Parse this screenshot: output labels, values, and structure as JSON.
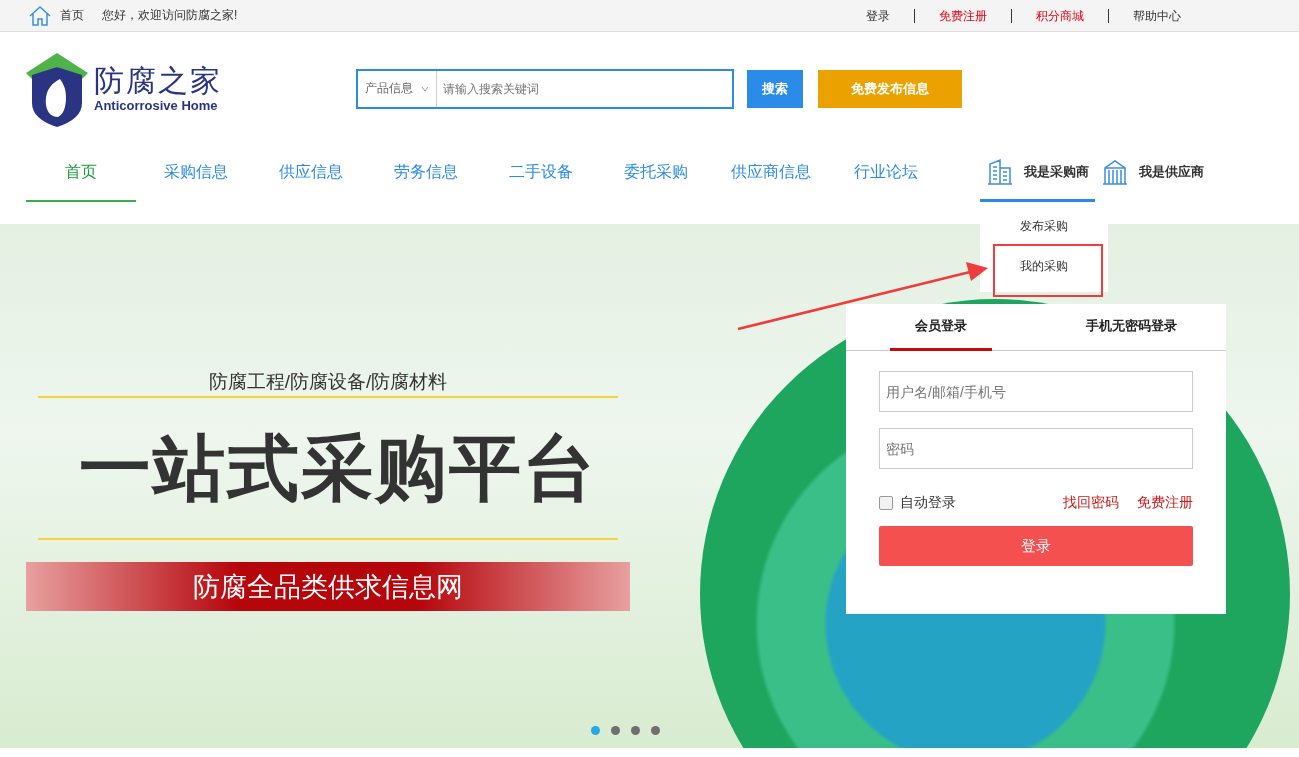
{
  "top_bar": {
    "home_link": "首页",
    "greeting": "您好，欢迎访问防腐之家!",
    "links": [
      {
        "label": "登录",
        "kind": "normal"
      },
      {
        "label": "免费注册",
        "kind": "highlight"
      },
      {
        "label": "积分商城",
        "kind": "highlight"
      },
      {
        "label": "帮助中心",
        "kind": "normal"
      }
    ]
  },
  "header": {
    "logo_name": "防腐之家",
    "logo_subtitle": "Anticorrosive Home",
    "search": {
      "category": "产品信息",
      "placeholder": "请输入搜索关键词",
      "button": "搜索"
    },
    "publish_button": "免费发布信息"
  },
  "nav": {
    "items": [
      {
        "label": "首页",
        "selected": true
      },
      {
        "label": "采购信息",
        "selected": false
      },
      {
        "label": "供应信息",
        "selected": false
      },
      {
        "label": "劳务信息",
        "selected": false
      },
      {
        "label": "二手设备",
        "selected": false
      },
      {
        "label": "委托采购",
        "selected": false
      },
      {
        "label": "供应商信息",
        "selected": false
      },
      {
        "label": "行业论坛",
        "selected": false
      }
    ],
    "roles": [
      {
        "label": "我是采购商",
        "selected": true,
        "expanded": true,
        "menu": [
          {
            "label": "发布采购",
            "annotated": false
          },
          {
            "label": "我的采购",
            "annotated": true
          }
        ]
      },
      {
        "label": "我是供应商",
        "selected": false
      }
    ]
  },
  "banner": {
    "subtitle": "防腐工程/防腐设备/防腐材料",
    "headline": "一站式采购平台",
    "tagline": "防腐全品类供求信息网",
    "carousel_dots": [
      {
        "selected": true
      },
      {
        "selected": false
      },
      {
        "selected": false
      },
      {
        "selected": false
      }
    ]
  },
  "login": {
    "tabs": [
      {
        "label": "会员登录",
        "selected": true
      },
      {
        "label": "手机无密码登录",
        "selected": false
      }
    ],
    "username_placeholder": "用户名/邮箱/手机号",
    "password_placeholder": "密码",
    "remember": {
      "label": "自动登录",
      "checked": false
    },
    "links": [
      "找回密码",
      "免费注册"
    ],
    "submit": "登录"
  }
}
